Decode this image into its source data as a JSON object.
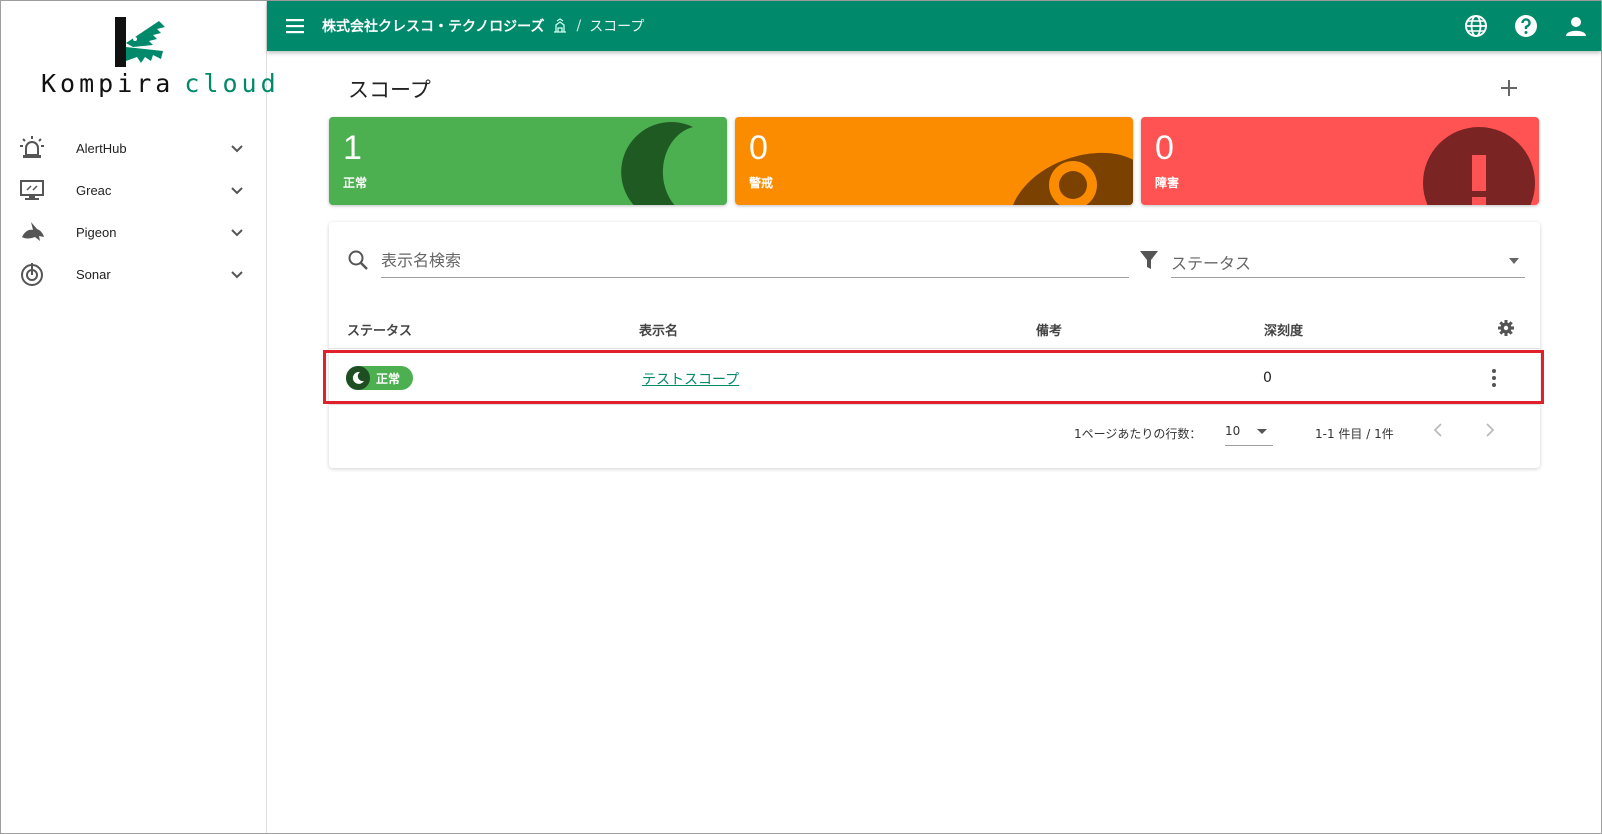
{
  "brand": {
    "logo_left": "Kompira",
    "logo_right": "cloud",
    "color": "#00896b"
  },
  "sidebar": {
    "items": [
      {
        "label": "AlertHub",
        "icon": "siren-icon"
      },
      {
        "label": "Greac",
        "icon": "monitor-icon"
      },
      {
        "label": "Pigeon",
        "icon": "pigeon-icon"
      },
      {
        "label": "Sonar",
        "icon": "sonar-icon"
      }
    ]
  },
  "topbar": {
    "org_name": "株式会社クレスコ・テクノロジーズ",
    "separator": "/",
    "current": "スコープ",
    "icons": [
      "globe-icon",
      "help-icon",
      "account-icon"
    ]
  },
  "page": {
    "title": "スコープ",
    "add_icon": "plus-icon"
  },
  "summary": [
    {
      "count": "1",
      "label": "正常",
      "color": "#4caf50",
      "icon": "moon-icon"
    },
    {
      "count": "0",
      "label": "警戒",
      "color": "#fb8c00",
      "icon": "eye-icon"
    },
    {
      "count": "0",
      "label": "障害",
      "color": "#ff5252",
      "icon": "exclamation-icon"
    }
  ],
  "filters": {
    "search_placeholder": "表示名検索",
    "status_placeholder": "ステータス"
  },
  "table": {
    "headers": [
      "ステータス",
      "表示名",
      "備考",
      "深刻度"
    ],
    "rows": [
      {
        "status": "正常",
        "name": "テストスコープ",
        "note": "",
        "severity": "0"
      }
    ]
  },
  "pagination": {
    "rows_per_page_label": "1ページあたりの行数：",
    "rows_per_page": "10",
    "range": "1-1 件目 / 1件"
  },
  "colors": {
    "highlight": "#e0212b"
  }
}
